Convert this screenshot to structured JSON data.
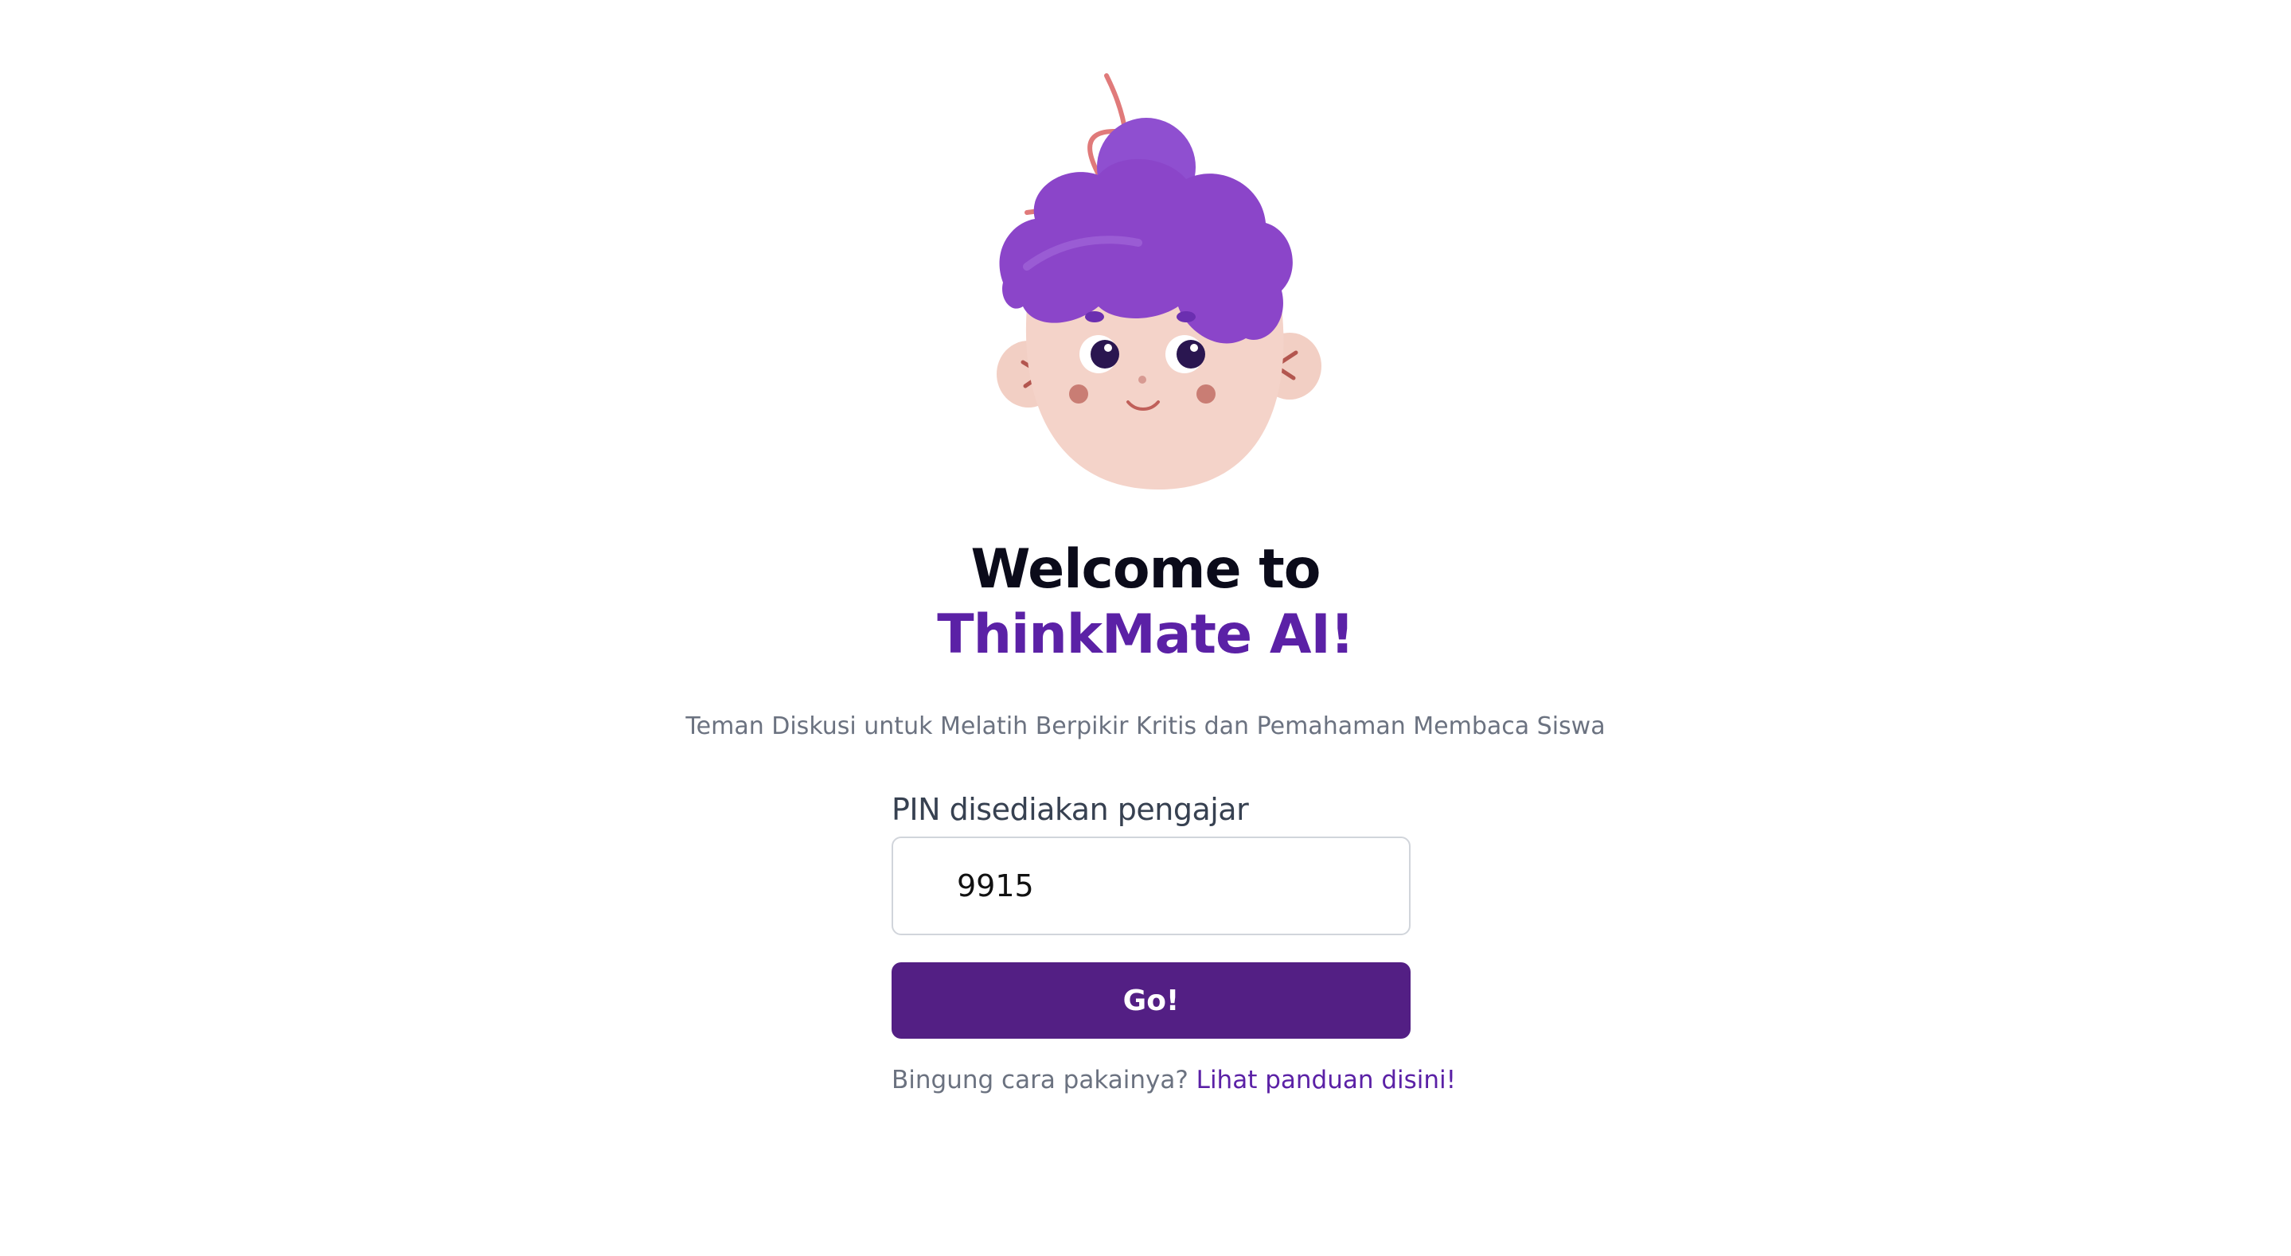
{
  "header": {
    "title_line1": "Welcome to",
    "title_line2": "ThinkMate AI!",
    "subtitle": "Teman Diskusi untuk Melatih Berpikir Kritis dan Pemahaman Membaca Siswa"
  },
  "form": {
    "pin_label": "PIN disediakan pengajar",
    "pin_value": "9915",
    "submit_label": "Go!"
  },
  "help": {
    "question": "Bingung cara pakainya?",
    "link_label": "Lihat panduan disini!"
  },
  "colors": {
    "accent": "#5b21a6",
    "button": "#531f84",
    "hair": "#8b45c9",
    "skin": "#f4d3c9"
  },
  "icons": {
    "mascot": "girl-mascot-illustration"
  }
}
